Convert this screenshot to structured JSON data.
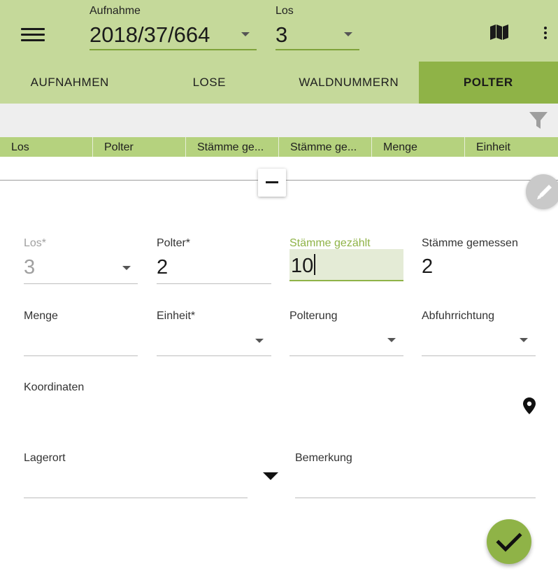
{
  "header": {
    "aufnahme": {
      "label": "Aufnahme",
      "value": "2018/37/664"
    },
    "los": {
      "label": "Los",
      "value": "3"
    },
    "icons": {
      "menu": "menu-icon",
      "map": "map-icon",
      "more": "more-vert-icon"
    }
  },
  "tabs": [
    {
      "label": "AUFNAHMEN",
      "active": false
    },
    {
      "label": "LOSE",
      "active": false
    },
    {
      "label": "WALDNUMMERN",
      "active": false
    },
    {
      "label": "POLTER",
      "active": true
    }
  ],
  "filter": {
    "icon": "filter-icon"
  },
  "table": {
    "columns": [
      "Los",
      "Polter",
      "Stämme ge...",
      "Stämme ge...",
      "Menge",
      "Einheit"
    ]
  },
  "form": {
    "los": {
      "label": "Los*",
      "value": "3"
    },
    "polter": {
      "label": "Polter*",
      "value": "2"
    },
    "staemme_gezaehlt": {
      "label": "Stämme gezählt",
      "value": "10"
    },
    "staemme_gemessen": {
      "label": "Stämme gemessen",
      "value": "2"
    },
    "menge": {
      "label": "Menge",
      "value": ""
    },
    "einheit": {
      "label": "Einheit*",
      "value": ""
    },
    "polterung": {
      "label": "Polterung",
      "value": ""
    },
    "abfuhrrichtung": {
      "label": "Abfuhrrichtung",
      "value": ""
    },
    "koordinaten": {
      "label": "Koordinaten",
      "value": ""
    },
    "lagerort": {
      "label": "Lagerort",
      "value": ""
    },
    "bemerkung": {
      "label": "Bemerkung",
      "value": ""
    }
  },
  "colors": {
    "appbar": "#c5d99a",
    "tab_active": "#8fb347",
    "table_header": "#b5d27e",
    "accent": "#8fb347",
    "focused_field_bg": "#e4ebd6"
  }
}
